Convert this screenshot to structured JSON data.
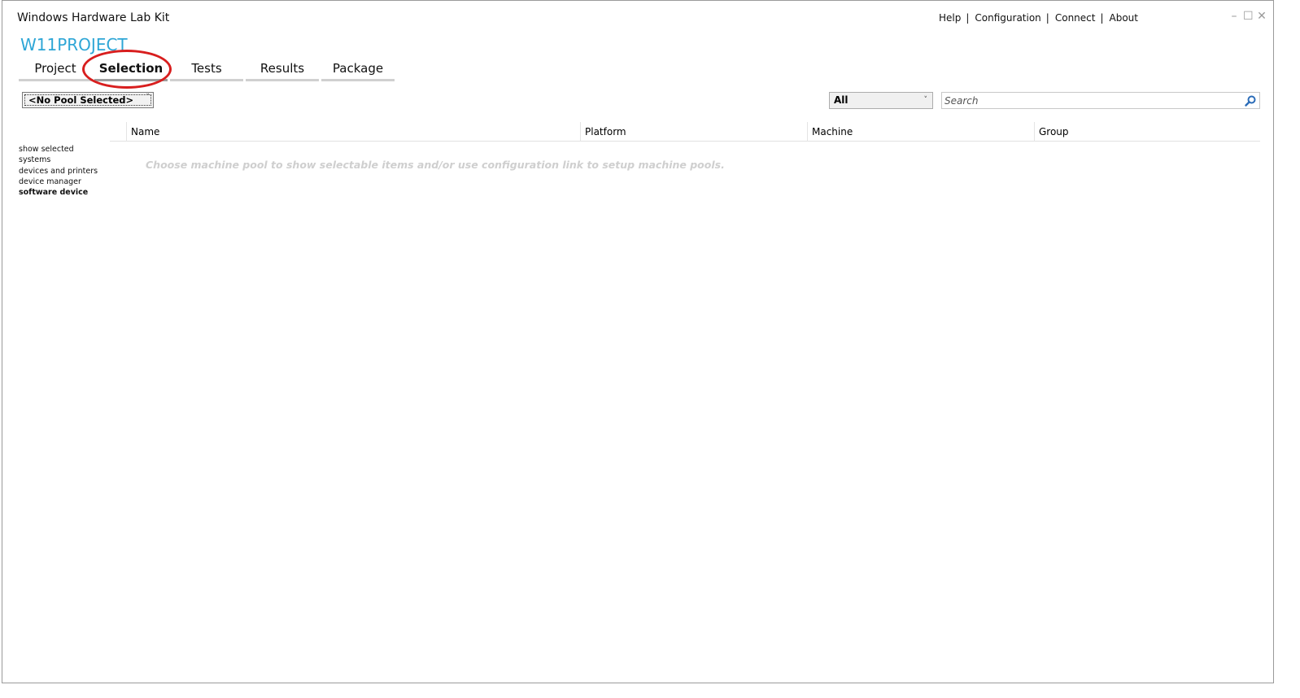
{
  "app": {
    "title": "Windows Hardware Lab Kit",
    "project_name": "W11PROJECT"
  },
  "top_links": {
    "help": "Help",
    "configuration": "Configuration",
    "connect": "Connect",
    "about": "About",
    "separator": "|"
  },
  "window_controls": {
    "minimize": "–",
    "maximize": "☐",
    "close": "✕"
  },
  "tabs": [
    {
      "label": "Project"
    },
    {
      "label": "Selection"
    },
    {
      "label": "Tests"
    },
    {
      "label": "Results"
    },
    {
      "label": "Package"
    }
  ],
  "active_tab": "Selection",
  "pool_select": {
    "value": "<No Pool Selected>",
    "chevron": "˅"
  },
  "filter_select": {
    "value": "All",
    "chevron": "˅"
  },
  "search": {
    "placeholder": "Search"
  },
  "side_filters": [
    {
      "label": "show selected"
    },
    {
      "label": "systems"
    },
    {
      "label": "devices and printers"
    },
    {
      "label": "device manager"
    },
    {
      "label": "software device"
    }
  ],
  "grid": {
    "columns": [
      "Name",
      "Platform",
      "Machine",
      "Group"
    ],
    "empty_message": "Choose machine pool to show selectable items and/or use configuration link to setup machine pools."
  },
  "colors": {
    "project_name": "#2ea6d6",
    "highlight": "#d81e1e"
  },
  "icons": {
    "search": "search-icon"
  }
}
